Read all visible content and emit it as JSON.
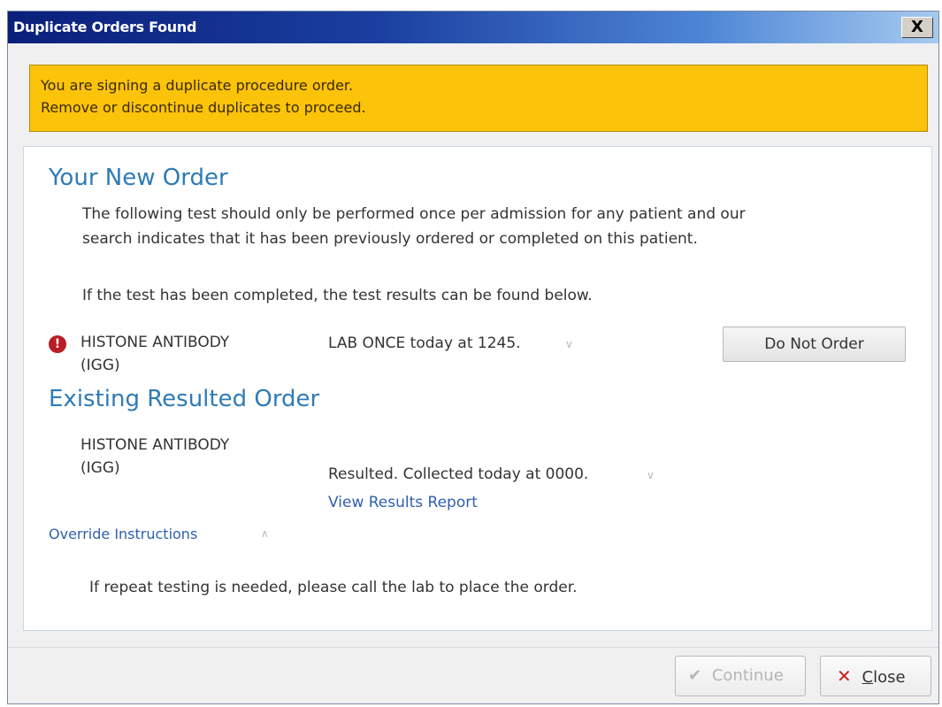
{
  "window": {
    "title": "Duplicate Orders Found",
    "close_glyph": "X"
  },
  "warning": {
    "line1": "You are signing a duplicate procedure order.",
    "line2": "Remove or discontinue duplicates to proceed.",
    "color": "#fcc30b"
  },
  "new_order": {
    "heading": "Your New Order",
    "description_line1": "The following test should only be performed once per admission for any patient and our",
    "description_line2": "search indicates that it has been previously ordered or completed on this patient.",
    "note": "If the test has been completed, the test results can be found below.",
    "icon": "error-icon",
    "icon_glyph": "!",
    "test_name_line1": "HISTONE ANTIBODY",
    "test_name_line2": "(IGG)",
    "order_detail": "LAB ONCE today at 1245.",
    "expand_glyph": "∨",
    "do_not_order_label": "Do Not Order"
  },
  "existing_order": {
    "heading": "Existing Resulted Order",
    "test_name_line1": "HISTONE ANTIBODY",
    "test_name_line2": "(IGG)",
    "status": "Resulted. Collected today at 0000.",
    "expand_glyph": "∨",
    "view_results_label": "View Results Report"
  },
  "override": {
    "label": "Override Instructions",
    "collapse_glyph": "∧",
    "text": "If repeat testing is needed, please call the lab to place the order."
  },
  "footer": {
    "continue_icon": "checkmark-icon",
    "continue_glyph": "✔",
    "continue_label": "Continue",
    "close_icon": "close-icon",
    "close_glyph": "✕",
    "close_label_first": "C",
    "close_label_rest": "lose"
  },
  "colors": {
    "heading": "#2f7bb5",
    "link": "#2f5fb0",
    "error": "#b81d25"
  }
}
